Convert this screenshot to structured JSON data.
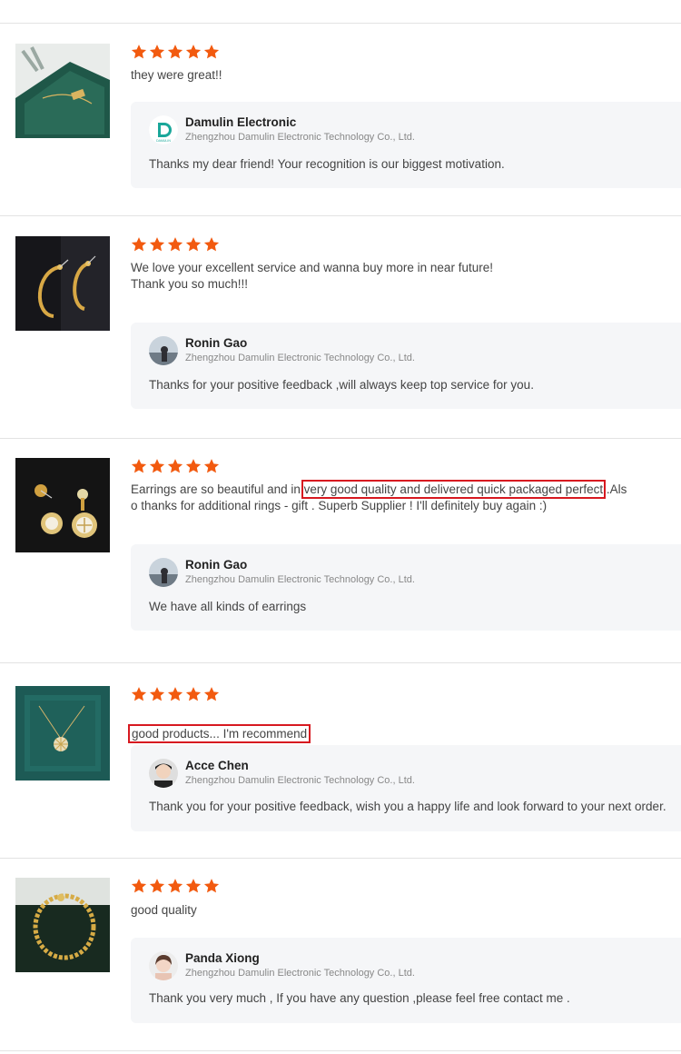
{
  "accent": "#f25a0f",
  "highlight_color": "#d71920",
  "reviews": [
    {
      "rating": 5,
      "text": "they were great!!",
      "reply": {
        "name": "Damulin Electronic",
        "company": "Zhengzhou Damulin Electronic Technology Co., Ltd.",
        "text": "Thanks my dear friend! Your recognition is our biggest motivation."
      }
    },
    {
      "rating": 5,
      "text": "We love your excellent service and wanna buy more in near future!\nThank you so much!!!",
      "reply": {
        "name": "Ronin Gao",
        "company": "Zhengzhou Damulin Electronic Technology Co., Ltd.",
        "text": "Thanks for your positive feedback ,will always keep top service for you."
      }
    },
    {
      "rating": 5,
      "text_before": "Earrings are so beautiful and in ",
      "text_highlight": "very good quality and delivered quick packaged  perfect",
      "text_after": " .Als",
      "text_line2": "o thanks for additional rings - gift . Superb Supplier ! I'll definitely buy again :)",
      "reply": {
        "name": "Ronin Gao",
        "company": "Zhengzhou Damulin Electronic Technology Co., Ltd.",
        "text": "We have all kinds of earrings"
      }
    },
    {
      "rating": 5,
      "text": "good products... I'm recommend",
      "reply": {
        "name": "Acce Chen",
        "company": "Zhengzhou Damulin Electronic Technology Co., Ltd.",
        "text": "Thank you for your positive feedback, wish you a happy life and look forward to your next order."
      }
    },
    {
      "rating": 5,
      "text": "good quality",
      "reply": {
        "name": "Panda Xiong",
        "company": "Zhengzhou Damulin Electronic Technology Co., Ltd.",
        "text": "Thank you very much , If you have any question ,please feel free contact me ."
      }
    }
  ]
}
